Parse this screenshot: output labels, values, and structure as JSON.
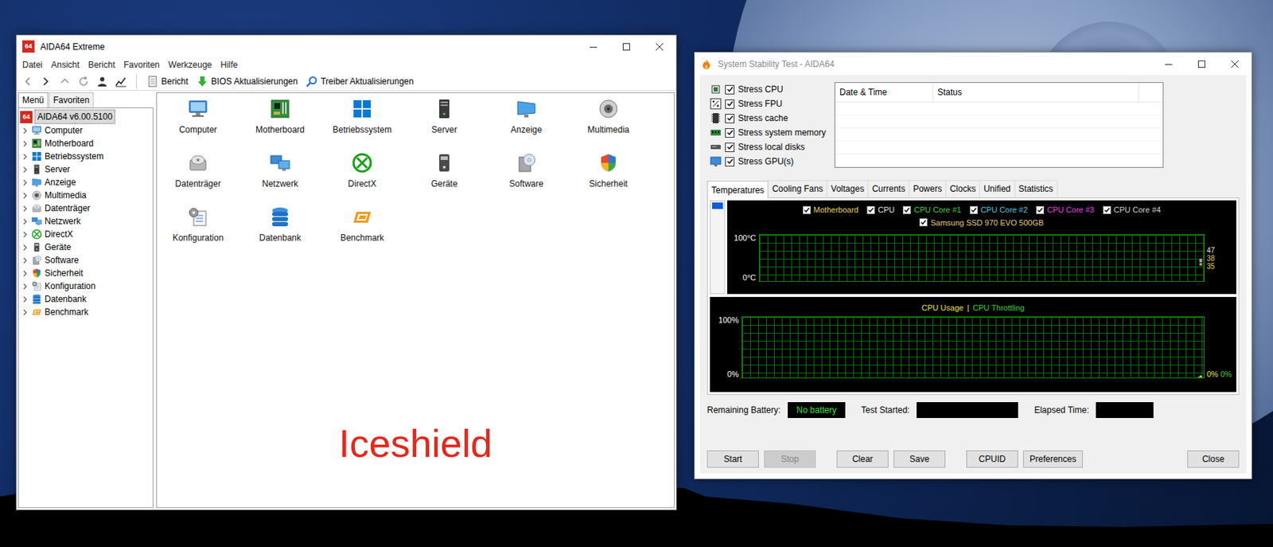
{
  "aida": {
    "title": "AIDA64 Extreme",
    "logo": "64",
    "menu": [
      "Datei",
      "Ansicht",
      "Bericht",
      "Favoriten",
      "Werkzeuge",
      "Hilfe"
    ],
    "toolbar": [
      "Bericht",
      "BIOS Aktualisierungen",
      "Treiber Aktualisierungen"
    ],
    "sidebar_tabs": [
      {
        "label": "Menü",
        "selected": true
      },
      {
        "label": "Favoriten",
        "selected": false
      }
    ],
    "tree_root": {
      "label": "AIDA64 v6.00.5100",
      "selected": true
    },
    "tree": [
      {
        "label": "Computer",
        "expanded": false
      },
      {
        "label": "Motherboard",
        "expanded": false
      },
      {
        "label": "Betriebssystem",
        "expanded": false
      },
      {
        "label": "Server",
        "expanded": false
      },
      {
        "label": "Anzeige",
        "expanded": false
      },
      {
        "label": "Multimedia",
        "expanded": false
      },
      {
        "label": "Datenträger",
        "expanded": false
      },
      {
        "label": "Netzwerk",
        "expanded": false
      },
      {
        "label": "DirectX",
        "expanded": false
      },
      {
        "label": "Geräte",
        "expanded": false
      },
      {
        "label": "Software",
        "expanded": false
      },
      {
        "label": "Sicherheit",
        "expanded": false
      },
      {
        "label": "Konfiguration",
        "expanded": false
      },
      {
        "label": "Datenbank",
        "expanded": false
      },
      {
        "label": "Benchmark",
        "expanded": false
      }
    ],
    "items": [
      "Computer",
      "Motherboard",
      "Betriebssystem",
      "Server",
      "Anzeige",
      "Multimedia",
      "Datenträger",
      "Netzwerk",
      "DirectX",
      "Geräte",
      "Software",
      "Sicherheit",
      "Konfiguration",
      "Datenbank",
      "Benchmark"
    ],
    "watermark": "Iceshield"
  },
  "stability": {
    "title": "System Stability Test - AIDA64",
    "stress": [
      {
        "label": "Stress CPU",
        "checked": true
      },
      {
        "label": "Stress FPU",
        "checked": true
      },
      {
        "label": "Stress cache",
        "checked": true
      },
      {
        "label": "Stress system memory",
        "checked": true
      },
      {
        "label": "Stress local disks",
        "checked": true
      },
      {
        "label": "Stress GPU(s)",
        "checked": true
      }
    ],
    "log": {
      "columns": [
        "Date & Time",
        "Status"
      ],
      "rows": []
    },
    "tabs": [
      {
        "label": "Temperatures",
        "selected": true
      },
      {
        "label": "Cooling Fans",
        "selected": false
      },
      {
        "label": "Voltages",
        "selected": false
      },
      {
        "label": "Currents",
        "selected": false
      },
      {
        "label": "Powers",
        "selected": false
      },
      {
        "label": "Clocks",
        "selected": false
      },
      {
        "label": "Unified",
        "selected": false
      },
      {
        "label": "Statistics",
        "selected": false
      }
    ],
    "temp_chart": {
      "y_max": "100°C",
      "y_min": "0°C",
      "series": [
        {
          "label": "Motherboard",
          "checked": true,
          "color": "#e8d44d",
          "values": [
            35,
            35,
            35
          ],
          "reading": "35"
        },
        {
          "label": "CPU",
          "checked": true,
          "color": "#e6e6e6",
          "values": [
            47,
            47,
            47
          ],
          "reading": "47"
        },
        {
          "label": "CPU Core #1",
          "checked": true,
          "color": "#3ccf3c",
          "values": [
            44,
            45,
            44
          ]
        },
        {
          "label": "CPU Core #2",
          "checked": true,
          "color": "#40c8e0",
          "values": [
            43,
            44,
            43
          ]
        },
        {
          "label": "CPU Core #3",
          "checked": true,
          "color": "#e040e0",
          "values": [
            46,
            46,
            45
          ]
        },
        {
          "label": "CPU Core #4",
          "checked": true,
          "color": "#cfcfcf",
          "values": [
            42,
            43,
            42
          ]
        },
        {
          "label": "Samsung SSD 970 EVO 500GB",
          "checked": true,
          "color": "#e6c87a",
          "values": [
            38,
            38,
            38
          ],
          "reading": "38"
        }
      ]
    },
    "usage_chart": {
      "y_max": "100%",
      "y_min": "0%",
      "separator": "|",
      "series": [
        {
          "label": "CPU Usage",
          "color": "#e8e04a",
          "values": [
            0,
            0,
            3,
            0
          ],
          "reading": "0%"
        },
        {
          "label": "CPU Throttling",
          "color": "#3ccf3c",
          "values": [
            0,
            0,
            0,
            0
          ],
          "reading": "0%"
        }
      ]
    },
    "battery": {
      "label": "Remaining Battery:",
      "value": "No battery"
    },
    "test_started": {
      "label": "Test Started:",
      "value": ""
    },
    "elapsed": {
      "label": "Elapsed Time:",
      "value": ""
    },
    "buttons": [
      {
        "label": "Start",
        "disabled": false
      },
      {
        "label": "Stop",
        "disabled": true
      },
      {
        "label": "Clear",
        "disabled": false
      },
      {
        "label": "Save",
        "disabled": false
      },
      {
        "label": "CPUID",
        "disabled": false
      },
      {
        "label": "Preferences",
        "disabled": false
      },
      {
        "label": "Close",
        "disabled": false
      }
    ]
  }
}
